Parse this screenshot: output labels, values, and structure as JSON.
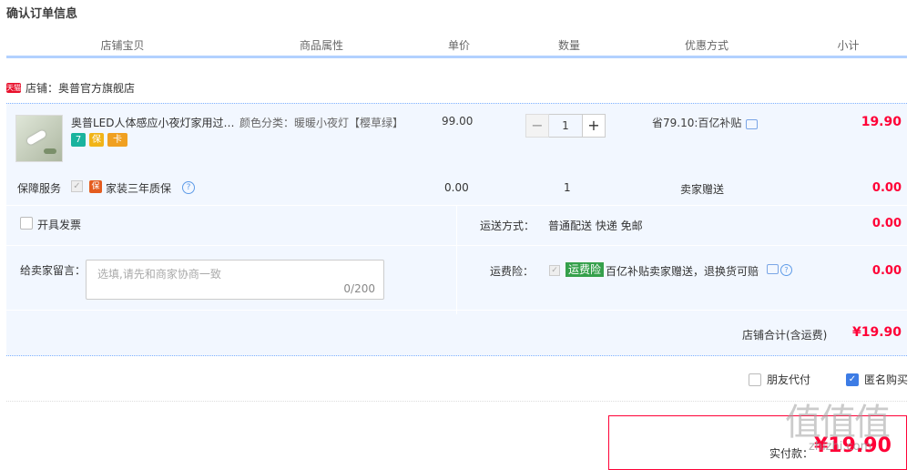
{
  "title": "确认订单信息",
  "columns": [
    "店铺宝贝",
    "商品属性",
    "单价",
    "数量",
    "优惠方式",
    "小计"
  ],
  "store": {
    "badge": "天猫",
    "label": "店铺：奥普官方旗舰店"
  },
  "item": {
    "title": "奥普LED人体感应小夜灯家用过道…",
    "attribute": "颜色分类：暖暖小夜灯【樱草绿】",
    "price": "99.00",
    "quantity": "1",
    "qty_minus": "−",
    "qty_plus": "+",
    "discount": "省79.10:百亿补贴",
    "subtotal": "19.90",
    "service_icons": [
      "7",
      "保",
      "卡"
    ]
  },
  "warranty": {
    "label": "保障服务",
    "badge": "保",
    "text": "家装三年质保",
    "price": "0.00",
    "quantity": "1",
    "gift": "卖家赠送",
    "subtotal": "0.00"
  },
  "invoice": {
    "label": "开具发票"
  },
  "shipping": {
    "label": "运送方式：",
    "value": "普通配送 快递 免邮",
    "fee": "0.00"
  },
  "message": {
    "label": "给卖家留言：",
    "placeholder": "选填,请先和商家协商一致",
    "count": "0/200"
  },
  "insurance": {
    "label": "运费险：",
    "badge": "运费险",
    "text": "百亿补贴卖家赠送，退换货可赔",
    "fee": "0.00"
  },
  "store_total": {
    "label": "店铺合计(含运费)",
    "value": "¥19.90"
  },
  "options": {
    "friend_pay": "朋友代付",
    "anonymous": "匿名购买",
    "anonymous_checked": true
  },
  "payment": {
    "label": "实付款：",
    "value": "¥19.90"
  },
  "watermark": {
    "main": "值值值",
    "sub": "zhizhi.com"
  },
  "colors": {
    "accent_red": "#ff0036",
    "header_rule": "#b2d1ff",
    "panel_bg": "#f2f7ff",
    "insurance_green": "#35a04b"
  }
}
